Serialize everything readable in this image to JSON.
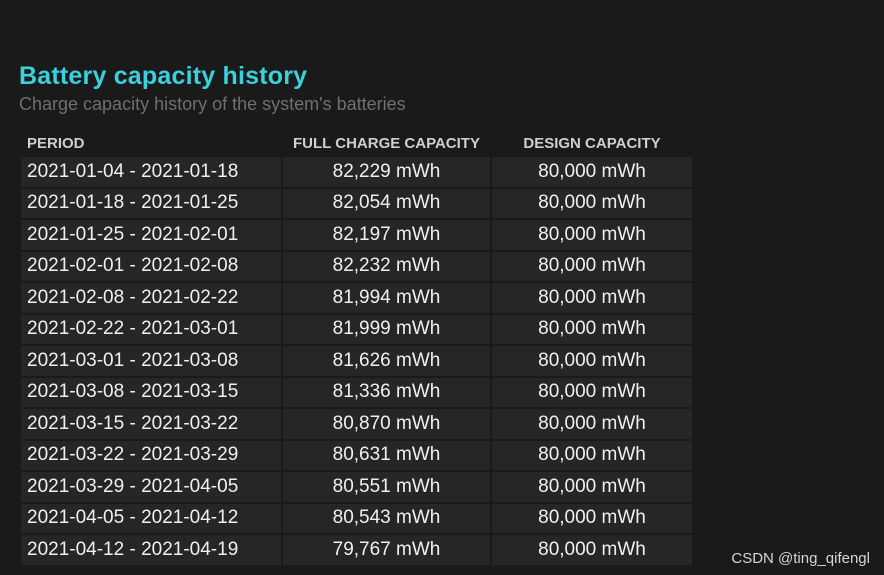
{
  "report": {
    "title": "Battery capacity history",
    "subtitle": "Charge capacity history of the system's batteries"
  },
  "table": {
    "headers": [
      "PERIOD",
      "FULL CHARGE CAPACITY",
      "DESIGN CAPACITY"
    ],
    "rows": [
      [
        "2021-01-04 - 2021-01-18",
        "82,229 mWh",
        "80,000 mWh"
      ],
      [
        "2021-01-18 - 2021-01-25",
        "82,054 mWh",
        "80,000 mWh"
      ],
      [
        "2021-01-25 - 2021-02-01",
        "82,197 mWh",
        "80,000 mWh"
      ],
      [
        "2021-02-01 - 2021-02-08",
        "82,232 mWh",
        "80,000 mWh"
      ],
      [
        "2021-02-08 - 2021-02-22",
        "81,994 mWh",
        "80,000 mWh"
      ],
      [
        "2021-02-22 - 2021-03-01",
        "81,999 mWh",
        "80,000 mWh"
      ],
      [
        "2021-03-01 - 2021-03-08",
        "81,626 mWh",
        "80,000 mWh"
      ],
      [
        "2021-03-08 - 2021-03-15",
        "81,336 mWh",
        "80,000 mWh"
      ],
      [
        "2021-03-15 - 2021-03-22",
        "80,870 mWh",
        "80,000 mWh"
      ],
      [
        "2021-03-22 - 2021-03-29",
        "80,631 mWh",
        "80,000 mWh"
      ],
      [
        "2021-03-29 - 2021-04-05",
        "80,551 mWh",
        "80,000 mWh"
      ],
      [
        "2021-04-05 - 2021-04-12",
        "80,543 mWh",
        "80,000 mWh"
      ],
      [
        "2021-04-12 - 2021-04-19",
        "79,767 mWh",
        "80,000 mWh"
      ]
    ]
  },
  "watermark": "CSDN @ting_qifengl",
  "colors": {
    "background": "#1a1a1a",
    "title": "#3ad0dd",
    "subtitle": "#6f6f6f",
    "cell_background": "#262626"
  }
}
